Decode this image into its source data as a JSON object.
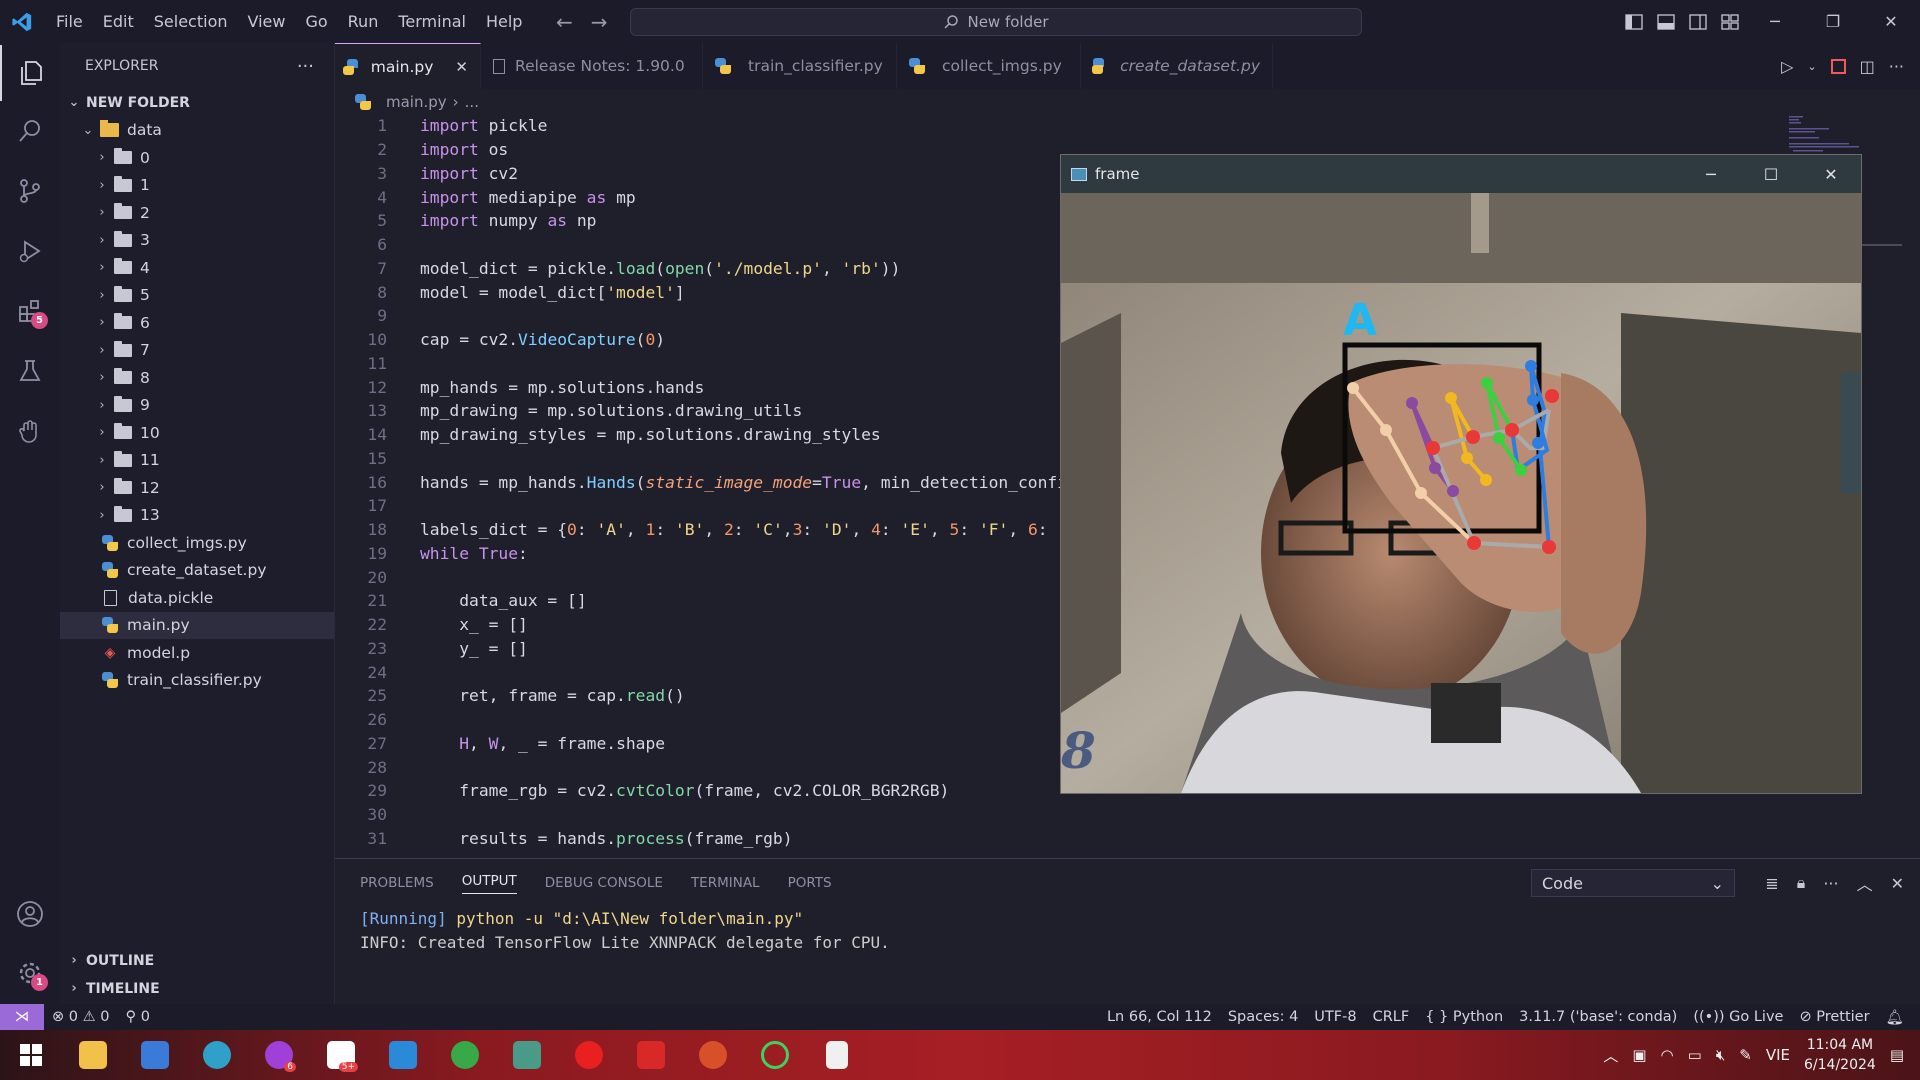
{
  "menu": [
    "File",
    "Edit",
    "Selection",
    "View",
    "Go",
    "Run",
    "Terminal",
    "Help"
  ],
  "command_center": "New folder",
  "explorer": {
    "title": "EXPLORER",
    "root": "NEW FOLDER",
    "data_folder": "data",
    "subfolders": [
      "0",
      "1",
      "2",
      "3",
      "4",
      "5",
      "6",
      "7",
      "8",
      "9",
      "10",
      "11",
      "12",
      "13"
    ],
    "files": [
      {
        "name": "collect_imgs.py",
        "type": "py"
      },
      {
        "name": "create_dataset.py",
        "type": "py"
      },
      {
        "name": "data.pickle",
        "type": "file"
      },
      {
        "name": "main.py",
        "type": "py",
        "selected": true
      },
      {
        "name": "model.p",
        "type": "model"
      },
      {
        "name": "train_classifier.py",
        "type": "py"
      }
    ],
    "outline": "OUTLINE",
    "timeline": "TIMELINE"
  },
  "activity": {
    "extensions_badge": "5",
    "settings_badge": "1"
  },
  "tabs": [
    {
      "label": "main.py",
      "active": true,
      "icon": "py"
    },
    {
      "label": "Release Notes: 1.90.0",
      "icon": "doc"
    },
    {
      "label": "train_classifier.py",
      "icon": "py"
    },
    {
      "label": "collect_imgs.py",
      "icon": "py"
    },
    {
      "label": "create_dataset.py",
      "icon": "py",
      "italic": true
    }
  ],
  "breadcrumb": {
    "file": "main.py",
    "rest": "..."
  },
  "code": [
    "import pickle",
    "import os",
    "import cv2",
    "import mediapipe as mp",
    "import numpy as np",
    "",
    "model_dict = pickle.load(open('./model.p', 'rb'))",
    "model = model_dict['model']",
    "",
    "cap = cv2.VideoCapture(0)",
    "",
    "mp_hands = mp.solutions.hands",
    "mp_drawing = mp.solutions.drawing_utils",
    "mp_drawing_styles = mp.solutions.drawing_styles",
    "",
    "hands = mp_hands.Hands(static_image_mode=True, min_detection_confi",
    "",
    "labels_dict = {0: 'A', 1: 'B', 2: 'C',3: 'D', 4: 'E', 5: 'F', 6: 'G",
    "while True:",
    "",
    "    data_aux = []",
    "    x_ = []",
    "    y_ = []",
    "",
    "    ret, frame = cap.read()",
    "",
    "    H, W, _ = frame.shape",
    "",
    "    frame_rgb = cv2.cvtColor(frame, cv2.COLOR_BGR2RGB)",
    "",
    "    results = hands.process(frame_rgb)"
  ],
  "frame_window": {
    "title": "frame",
    "prediction": "A"
  },
  "panel": {
    "tabs": [
      "PROBLEMS",
      "OUTPUT",
      "DEBUG CONSOLE",
      "TERMINAL",
      "PORTS"
    ],
    "active_tab": "OUTPUT",
    "select_value": "Code",
    "output": [
      "[Running] python -u \"d:\\AI\\New folder\\main.py\"",
      "INFO: Created TensorFlow Lite XNNPACK delegate for CPU."
    ]
  },
  "status": {
    "errors": "0",
    "warnings": "0",
    "ports": "0",
    "position": "Ln 66, Col 112",
    "spaces": "Spaces: 4",
    "encoding": "UTF-8",
    "eol": "CRLF",
    "language": "Python",
    "interpreter": "3.11.7 ('base': conda)",
    "golive": "Go Live",
    "prettier": "Prettier"
  },
  "taskbar": {
    "lang": "VIE",
    "time": "11:04 AM",
    "date": "6/14/2024",
    "badges": {
      "messenger": "6",
      "zalo": "5+"
    }
  }
}
